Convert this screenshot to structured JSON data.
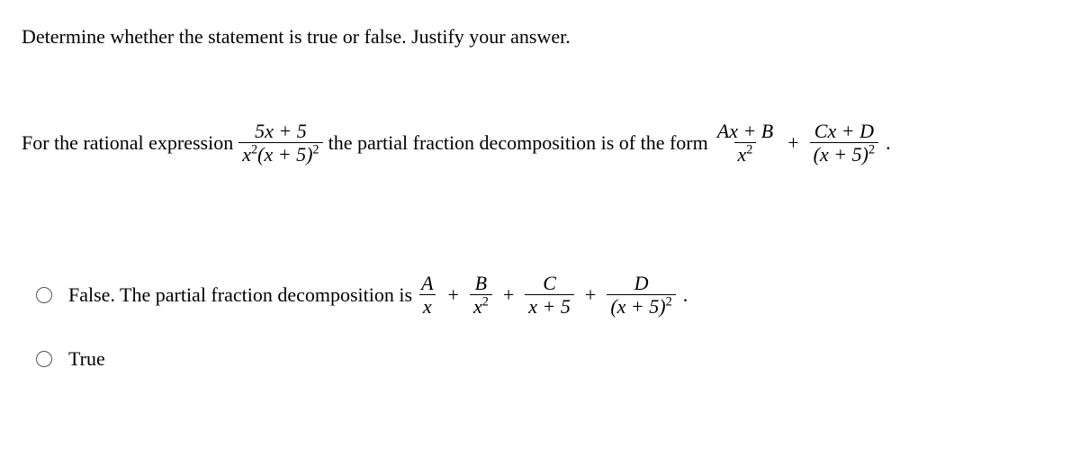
{
  "prompt": "Determine whether the statement is true or false. Justify your answer.",
  "statement": {
    "lead": "For the rational expression",
    "expr_num": "5x + 5",
    "expr_den_pre": "x",
    "expr_den_sup1": "2",
    "expr_den_mid": "(x + 5)",
    "expr_den_sup2": "2",
    "mid": "the partial fraction decomposition is of the form",
    "f1_num": "Ax + B",
    "f1_den_base": "x",
    "f1_den_sup": "2",
    "f2_num": "Cx + D",
    "f2_den_base": "(x + 5)",
    "f2_den_sup": "2",
    "plus": "+",
    "period": "."
  },
  "options": {
    "false_lead": "False. The partial fraction decomposition is",
    "tA_num": "A",
    "tA_den": "x",
    "tB_num": "B",
    "tB_den_base": "x",
    "tB_den_sup": "2",
    "tC_num": "C",
    "tC_den": "x + 5",
    "tD_num": "D",
    "tD_den_base": "(x + 5)",
    "tD_den_sup": "2",
    "plus": "+",
    "period": ".",
    "true_label": "True"
  }
}
